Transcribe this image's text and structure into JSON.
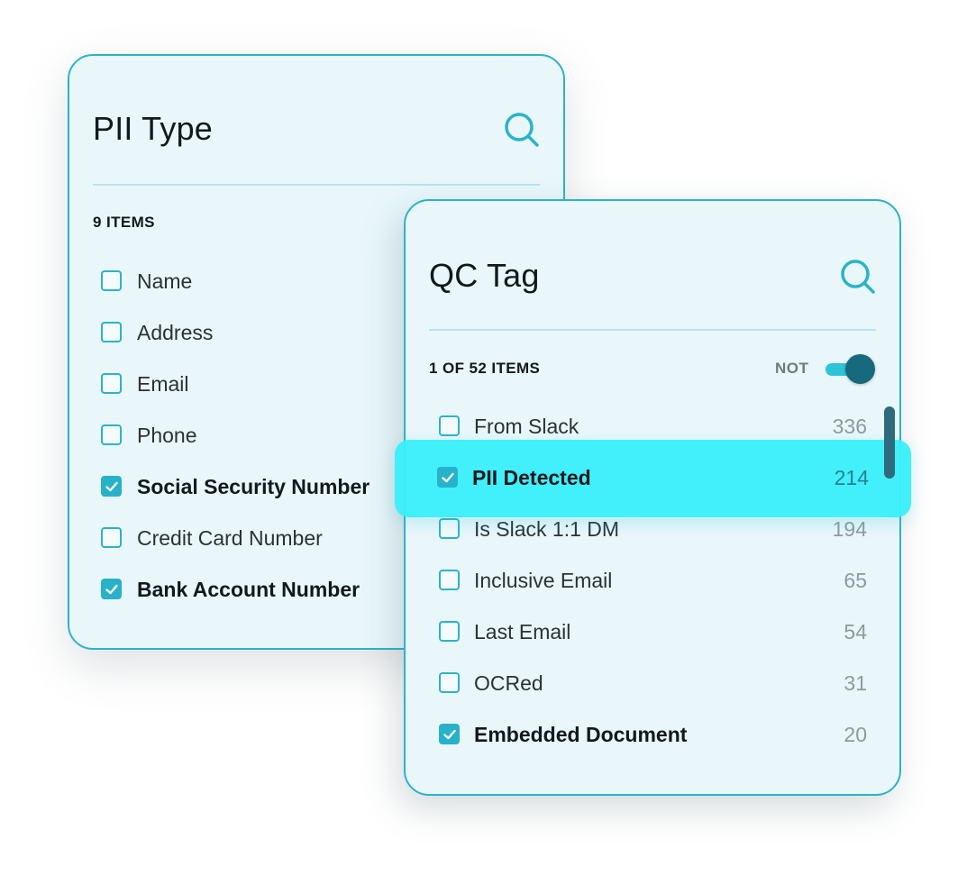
{
  "pii_panel": {
    "title": "PII Type",
    "count_label": "9 ITEMS",
    "items": [
      {
        "label": "Name",
        "checked": false
      },
      {
        "label": "Address",
        "checked": false
      },
      {
        "label": "Email",
        "checked": false
      },
      {
        "label": "Phone",
        "checked": false
      },
      {
        "label": "Social Security Number",
        "checked": true
      },
      {
        "label": "Credit Card Number",
        "checked": false
      },
      {
        "label": "Bank Account Number",
        "checked": true
      }
    ]
  },
  "qc_panel": {
    "title": "QC Tag",
    "count_label": "1 OF 52 ITEMS",
    "not_label": "NOT",
    "not_toggle_on": true,
    "items": [
      {
        "label": "From Slack",
        "count": "336",
        "checked": false
      },
      {
        "label": "PII Detected",
        "count": "214",
        "checked": true,
        "highlighted": true
      },
      {
        "label": "Is Slack 1:1 DM",
        "count": "194",
        "checked": false
      },
      {
        "label": "Inclusive Email",
        "count": "65",
        "checked": false
      },
      {
        "label": "Last Email",
        "count": "54",
        "checked": false
      },
      {
        "label": "OCRed",
        "count": "31",
        "checked": false
      },
      {
        "label": "Embedded Document",
        "count": "20",
        "checked": true
      }
    ]
  },
  "colors": {
    "accent": "#2bb3c9",
    "panel_bg": "#e9f7fb",
    "highlight": "#39f0fa",
    "toggle_knob": "#17697d"
  }
}
